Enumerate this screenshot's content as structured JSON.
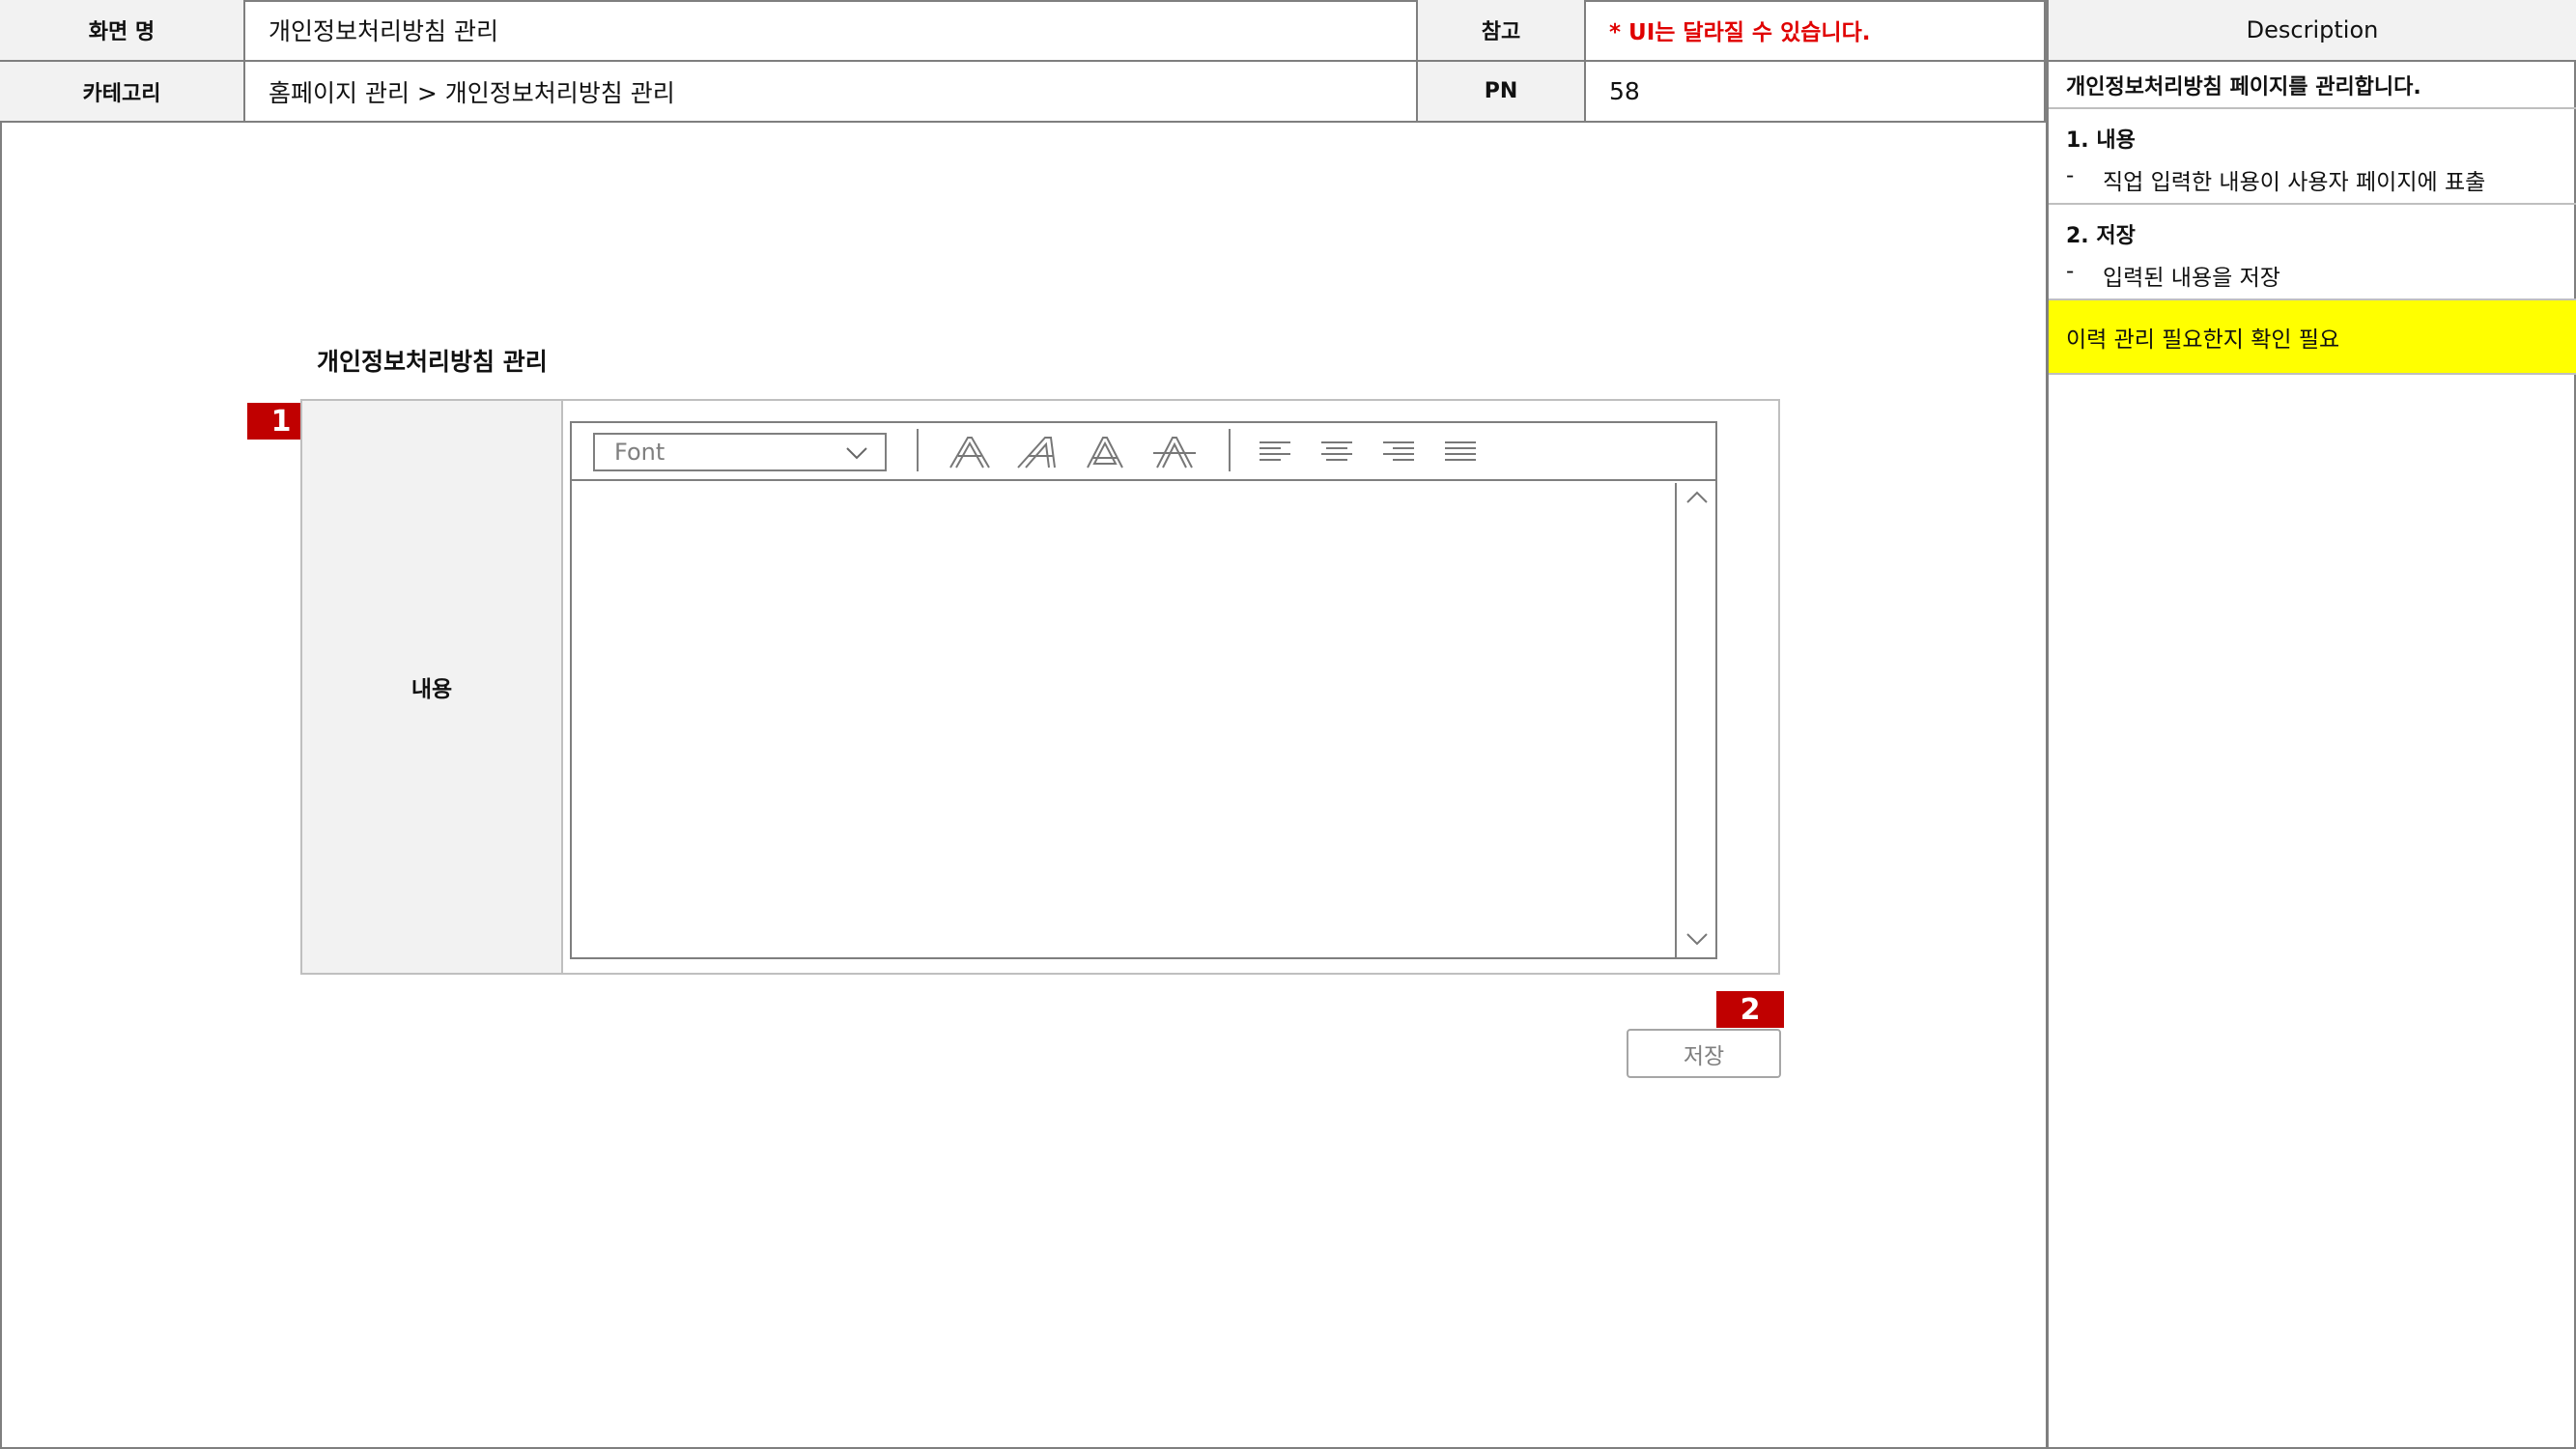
{
  "header": {
    "screen_name_label": "화면 명",
    "screen_name_value": "개인정보처리방침 관리",
    "reference_label": "참고",
    "reference_value": "* UI는 달라질 수 있습니다.",
    "category_label": "카테고리",
    "category_value": "홈페이지 관리 > 개인정보처리방침 관리",
    "pn_label": "PN",
    "pn_value": "58"
  },
  "description": {
    "title": "Description",
    "summary": "개인정보처리방침 페이지를 관리합니다.",
    "items": [
      {
        "heading": "1. 내용",
        "bullet": "-",
        "text": "직업 입력한 내용이 사용자 페이지에 표출"
      },
      {
        "heading": "2. 저장",
        "bullet": "-",
        "text": "입력된 내용을 저장"
      }
    ],
    "note": "이력 관리 필요한지 확인 필요"
  },
  "main": {
    "section_title": "개인정보처리방침 관리",
    "content_label": "내용",
    "editor": {
      "font_placeholder": "Font",
      "icons": [
        "font-bold-icon",
        "font-italic-icon",
        "font-outline-icon",
        "font-strikethrough-icon",
        "align-left-icon",
        "align-center-icon",
        "align-right-icon",
        "align-justify-icon",
        "scroll-up-icon",
        "scroll-down-icon",
        "chevron-down-icon"
      ]
    },
    "save_label": "저장",
    "markers": [
      "1",
      "2"
    ]
  },
  "colors": {
    "marker_red": "#c00000",
    "reference_red": "#e00000",
    "note_yellow": "#ffff00",
    "label_gray": "#f2f2f2"
  }
}
